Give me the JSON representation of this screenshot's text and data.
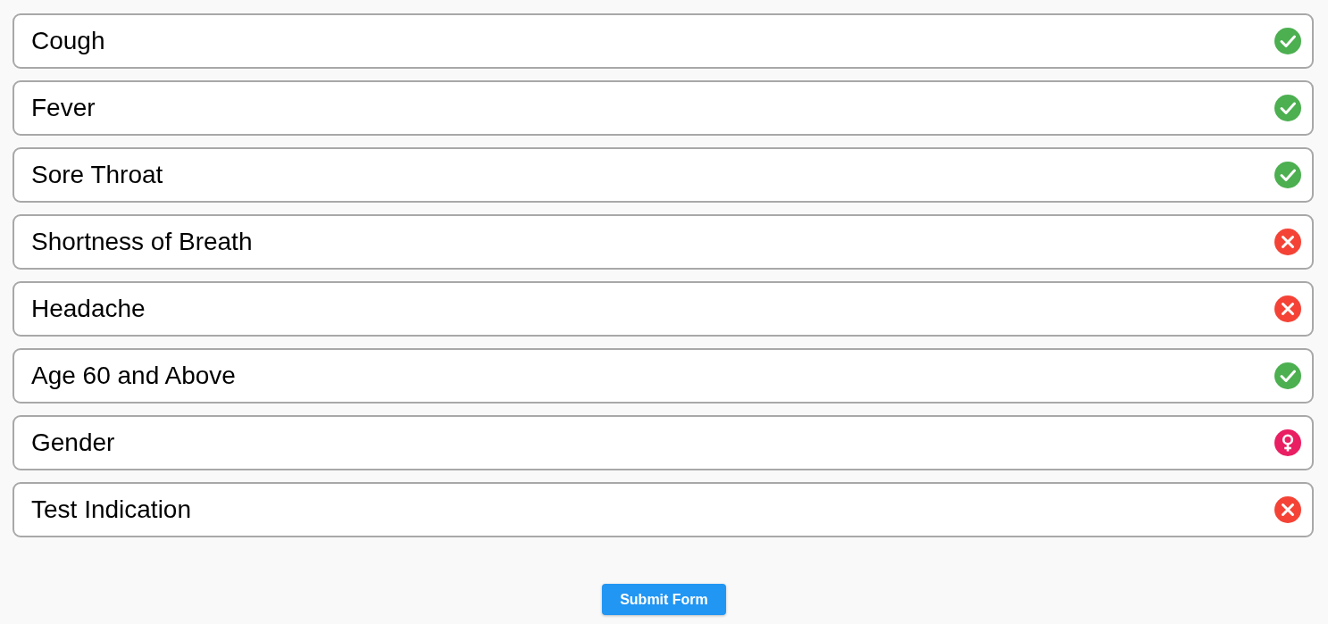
{
  "rows": [
    {
      "label": "Cough",
      "kind": "yes"
    },
    {
      "label": "Fever",
      "kind": "yes"
    },
    {
      "label": "Sore Throat",
      "kind": "yes"
    },
    {
      "label": "Shortness of Breath",
      "kind": "no"
    },
    {
      "label": "Headache",
      "kind": "no"
    },
    {
      "label": "Age 60 and Above",
      "kind": "yes"
    },
    {
      "label": "Gender",
      "kind": "female"
    },
    {
      "label": "Test Indication",
      "kind": "no"
    }
  ],
  "submit_button": {
    "label": "Submit Form"
  }
}
